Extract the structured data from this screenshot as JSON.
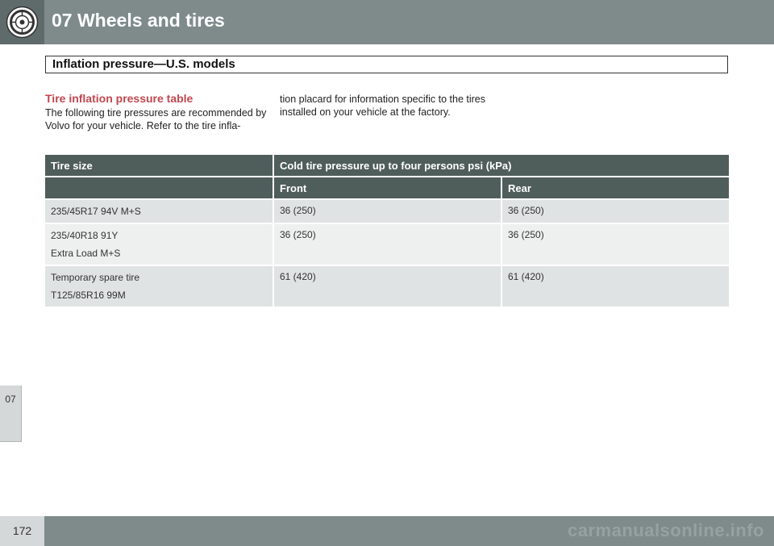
{
  "header": {
    "chapter_title": "07 Wheels and tires",
    "icon": "tire-icon"
  },
  "chapter_tab": {
    "label": "07"
  },
  "section": {
    "title": "Inflation pressure—U.S. models"
  },
  "content": {
    "subheading": "Tire inflation pressure table",
    "paragraph_col1": "The following tire pressures are recommended by Volvo for your vehicle. Refer to the tire infla-",
    "paragraph_col2": "tion placard for information specific to the tires installed on your vehicle at the factory."
  },
  "table": {
    "header_tire_size": "Tire size",
    "header_pressure": "Cold tire pressure up to four persons psi (kPa)",
    "header_front": "Front",
    "header_rear": "Rear",
    "rows": [
      {
        "size_line1": "235/45R17 94V M+S",
        "size_line2": "",
        "front": "36 (250)",
        "rear": "36 (250)"
      },
      {
        "size_line1": "235/40R18 91Y",
        "size_line2": "Extra Load M+S",
        "front": "36 (250)",
        "rear": "36 (250)"
      },
      {
        "size_line1": "Temporary spare tire",
        "size_line2": "T125/85R16 99M",
        "front": "61 (420)",
        "rear": "61 (420)"
      }
    ]
  },
  "footer": {
    "page_number": "172",
    "watermark": "carmanualsonline.info"
  }
}
